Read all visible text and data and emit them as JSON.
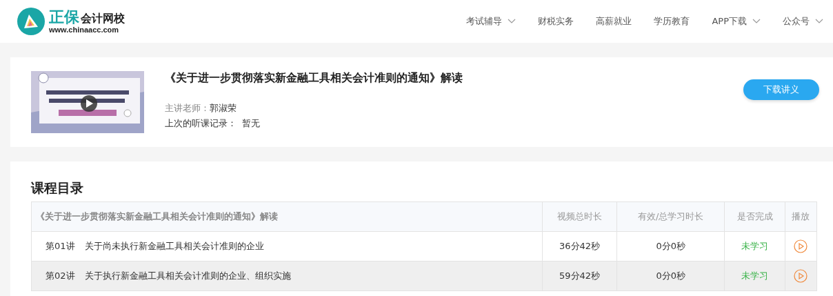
{
  "logo": {
    "brand": "正保",
    "name": "会计网校",
    "url": "www.chinaacc.com"
  },
  "nav": [
    {
      "label": "考试辅导",
      "dropdown": true
    },
    {
      "label": "财税实务",
      "dropdown": false
    },
    {
      "label": "高薪就业",
      "dropdown": false
    },
    {
      "label": "学历教育",
      "dropdown": false
    },
    {
      "label": "APP下载",
      "dropdown": true
    },
    {
      "label": "公众号",
      "dropdown": true
    }
  ],
  "course": {
    "title": "《关于进一步贯彻落实新金融工具相关会计准则的通知》解读",
    "teacher_label": "主讲老师：",
    "teacher": "郭淑荣",
    "history_label": "上次的听课记录：",
    "history": "暂无",
    "download_button": "下载讲义"
  },
  "catalog": {
    "heading": "课程目录",
    "columns": [
      "《关于进一步贯彻落实新金融工具相关会计准则的通知》解读",
      "视频总时长",
      "有效/总学习时长",
      "是否完成",
      "播放"
    ],
    "rows": [
      {
        "lesson": "第01讲",
        "title": "关于尚未执行新金融工具相关会计准则的企业",
        "duration": "36分42秒",
        "studied": "0分0秒",
        "status": "未学习",
        "selected": false
      },
      {
        "lesson": "第02讲",
        "title": "关于执行新金融工具相关会计准则的企业、组织实施",
        "duration": "59分42秒",
        "studied": "0分0秒",
        "status": "未学习",
        "selected": true
      }
    ]
  }
}
